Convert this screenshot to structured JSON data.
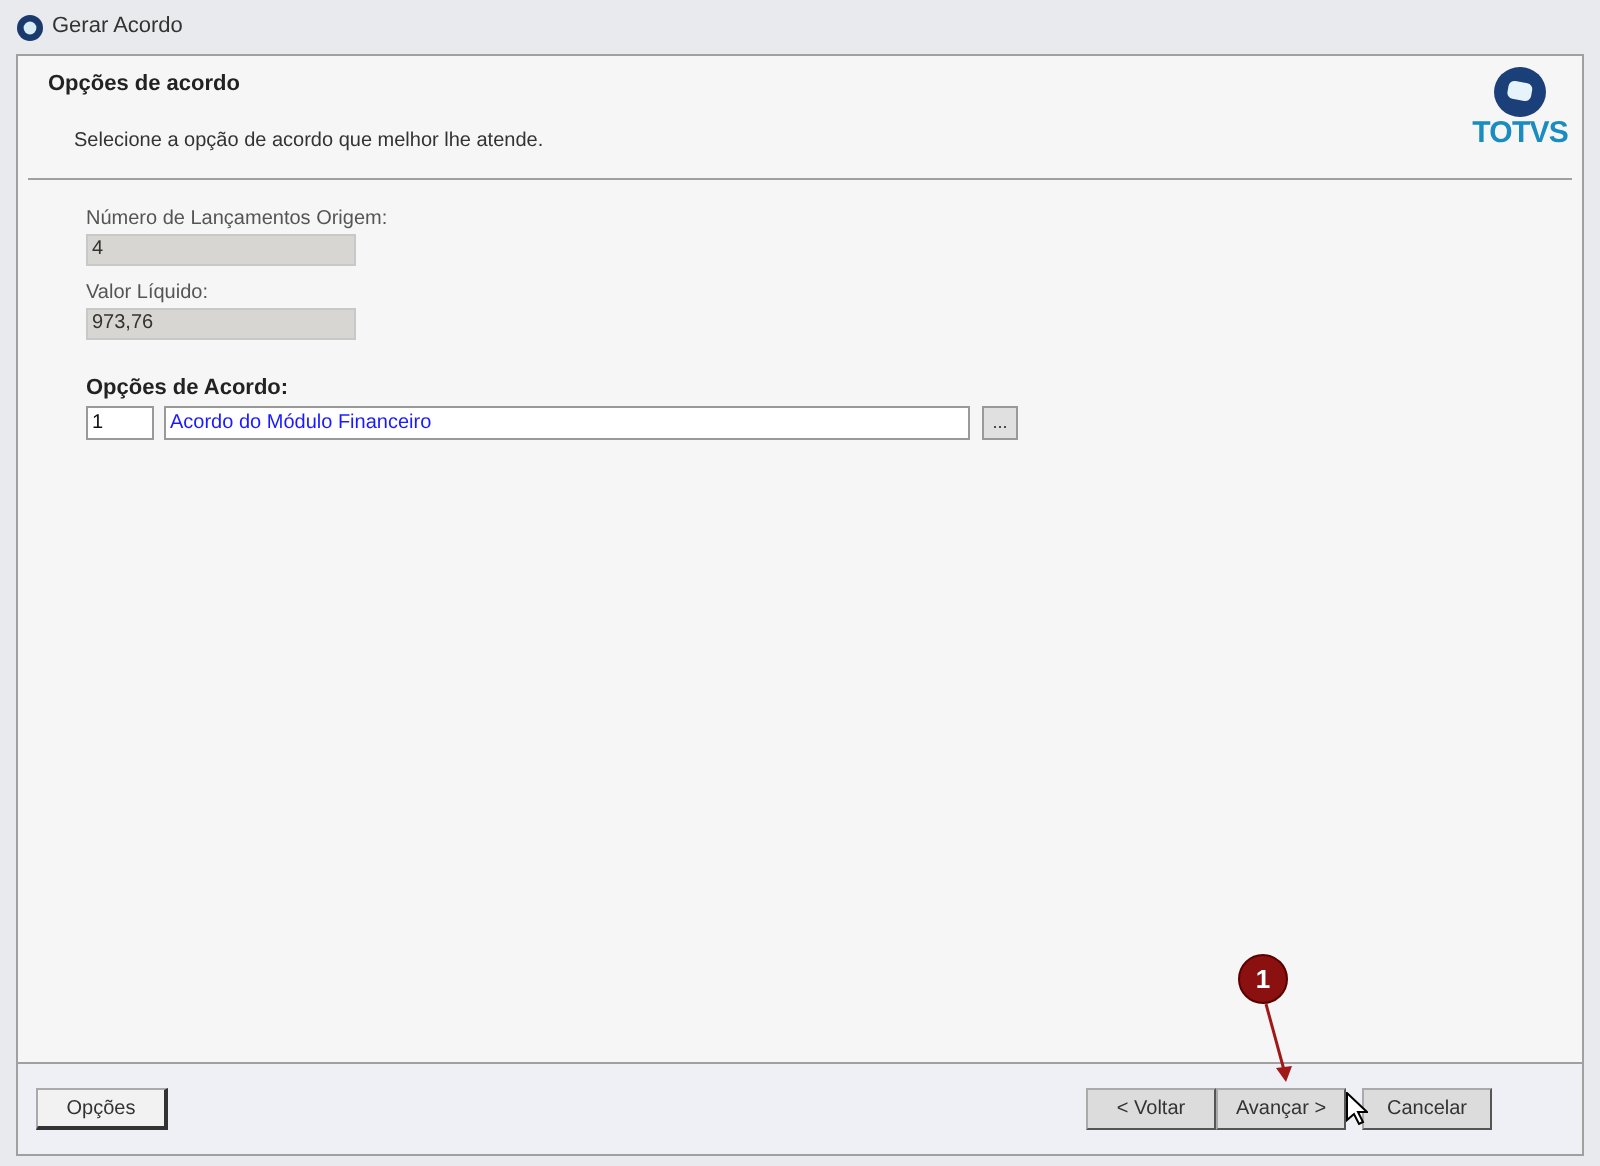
{
  "window": {
    "title": "Gerar Acordo"
  },
  "header": {
    "title": "Opções de acordo",
    "subtitle": "Selecione a opção de acordo que melhor lhe atende.",
    "logo_text": "TOTVS"
  },
  "fields": [
    {
      "label": "Número de Lançamentos Origem:",
      "value": "4"
    },
    {
      "label": "Valor Líquido:",
      "value": "973,76"
    }
  ],
  "agreement": {
    "label": "Opções de Acordo:",
    "code": "1",
    "description": "Acordo do Módulo Financeiro",
    "lookup_button": "..."
  },
  "footer": {
    "left_button": "Opções",
    "buttons": [
      "< Voltar",
      "Avançar >",
      "Cancelar"
    ]
  },
  "annotation": {
    "number": "1"
  }
}
